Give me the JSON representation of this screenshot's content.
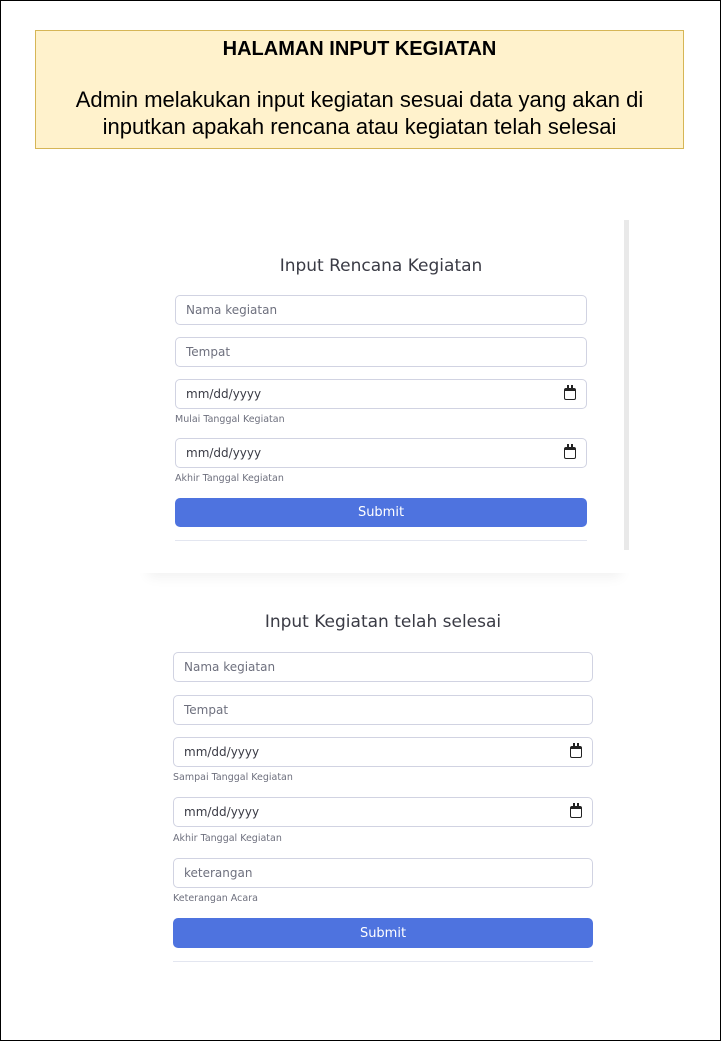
{
  "note": {
    "title": "HALAMAN INPUT KEGIATAN",
    "description": "Admin melakukan input kegiatan sesuai data yang akan di inputkan apakah rencana atau kegiatan telah selesai"
  },
  "form_plan": {
    "title": "Input Rencana Kegiatan",
    "name_placeholder": "Nama kegiatan",
    "place_placeholder": "Tempat",
    "start_date_value": "mm/dd/yyyy",
    "start_date_hint": "Mulai Tanggal Kegiatan",
    "end_date_value": "mm/dd/yyyy",
    "end_date_hint": "Akhir Tanggal Kegiatan",
    "submit_label": "Submit"
  },
  "form_done": {
    "title": "Input Kegiatan telah selesai",
    "name_placeholder": "Nama kegiatan",
    "place_placeholder": "Tempat",
    "start_date_value": "mm/dd/yyyy",
    "start_date_hint": "Sampai Tanggal Kegiatan",
    "end_date_value": "mm/dd/yyyy",
    "end_date_hint": "Akhir Tanggal Kegiatan",
    "notes_placeholder": "keterangan",
    "notes_hint": "Keterangan Acara",
    "submit_label": "Submit"
  },
  "icons": {
    "date_picker": "calendar-icon"
  },
  "colors": {
    "primary": "#4e73df",
    "note_bg": "#fff2cc",
    "note_border": "#d6b656"
  }
}
